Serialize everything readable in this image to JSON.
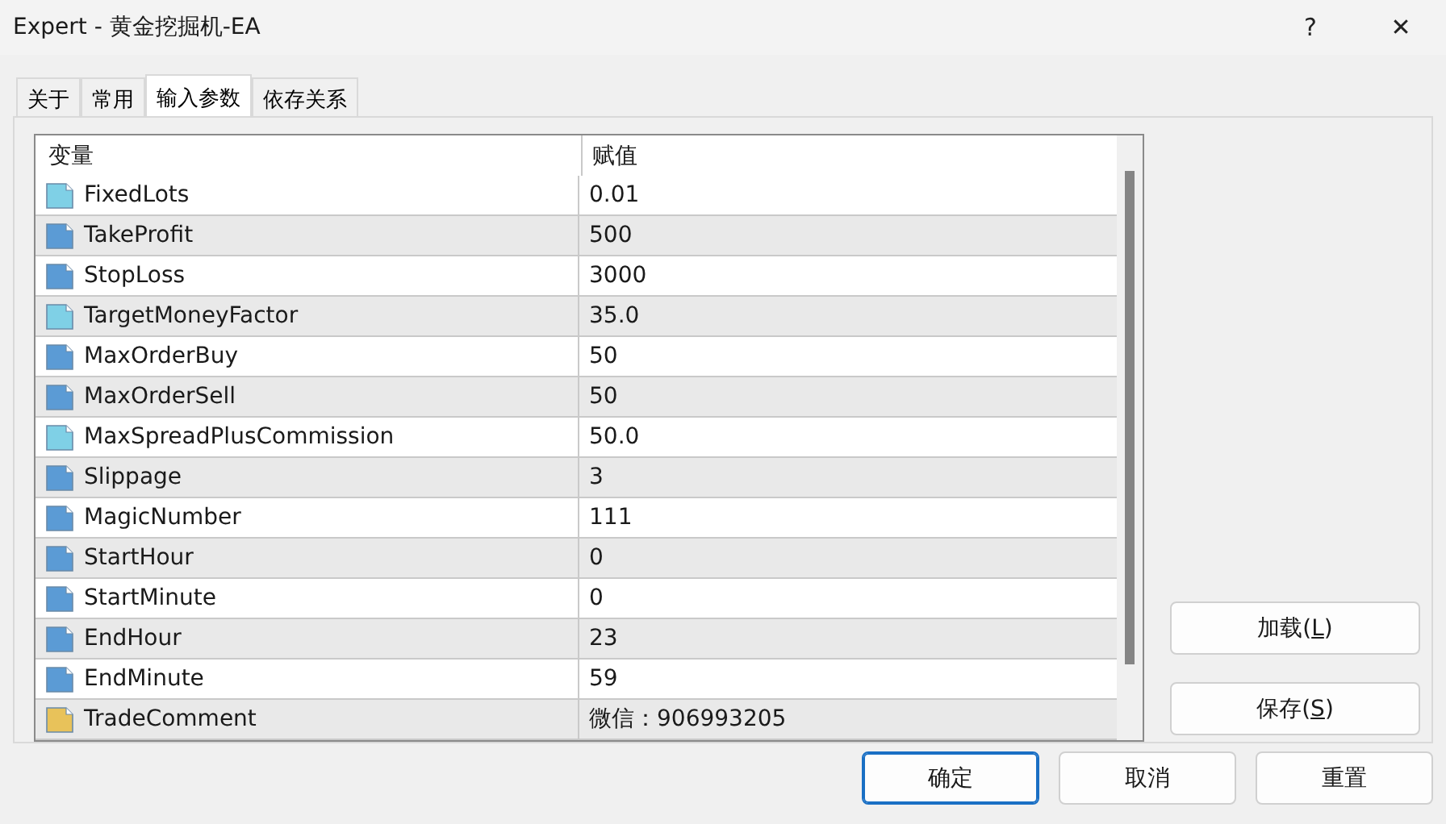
{
  "window": {
    "title": "Expert - 黄金挖掘机-EA",
    "help": "?",
    "close": "✕"
  },
  "tabs": [
    {
      "label": "关于",
      "selected": false
    },
    {
      "label": "常用",
      "selected": false
    },
    {
      "label": "输入参数",
      "selected": true
    },
    {
      "label": "依存关系",
      "selected": false
    }
  ],
  "table": {
    "columns": [
      "变量",
      "赋值"
    ],
    "rows": [
      {
        "kind": "double",
        "name": "FixedLots",
        "value": "0.01"
      },
      {
        "kind": "int",
        "name": "TakeProfit",
        "value": "500"
      },
      {
        "kind": "int",
        "name": "StopLoss",
        "value": "3000"
      },
      {
        "kind": "double",
        "name": "TargetMoneyFactor",
        "value": "35.0"
      },
      {
        "kind": "int",
        "name": "MaxOrderBuy",
        "value": "50"
      },
      {
        "kind": "int",
        "name": "MaxOrderSell",
        "value": "50"
      },
      {
        "kind": "double",
        "name": "MaxSpreadPlusCommission",
        "value": "50.0"
      },
      {
        "kind": "int",
        "name": "Slippage",
        "value": "3"
      },
      {
        "kind": "int",
        "name": "MagicNumber",
        "value": "111"
      },
      {
        "kind": "int",
        "name": "StartHour",
        "value": "0"
      },
      {
        "kind": "int",
        "name": "StartMinute",
        "value": "0"
      },
      {
        "kind": "int",
        "name": "EndHour",
        "value": "23"
      },
      {
        "kind": "int",
        "name": "EndMinute",
        "value": "59"
      },
      {
        "kind": "string",
        "name": "TradeComment",
        "value": "微信：906993205"
      }
    ]
  },
  "side_buttons": [
    {
      "label": "加载(",
      "key": "L",
      "end": ")"
    },
    {
      "label": "保存(",
      "key": "S",
      "end": ")"
    }
  ],
  "buttons": [
    {
      "label": "确定",
      "default": true
    },
    {
      "label": "取消",
      "default": false
    },
    {
      "label": "重置",
      "default": false
    }
  ]
}
